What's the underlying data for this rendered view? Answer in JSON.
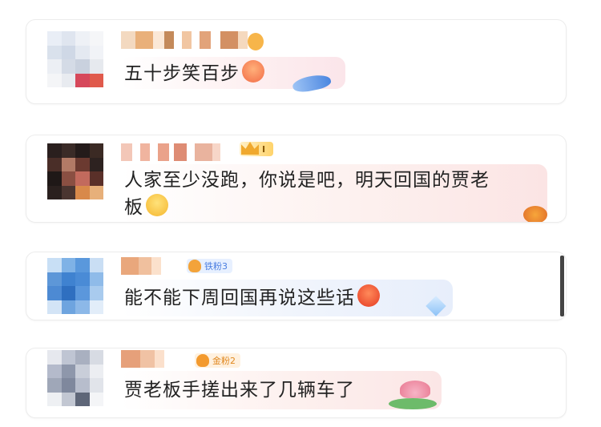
{
  "comments": [
    {
      "text": "五十步笑百步",
      "badge": ""
    },
    {
      "text_line1": "人家至少没跑，你说是吧，明天回国的贾老",
      "text_line2": "板",
      "badge": "I"
    },
    {
      "text": "能不能下周回国再说这些话",
      "badge": "铁粉3"
    },
    {
      "text": "贾老板手搓出来了几辆车了",
      "badge": "金粉2"
    }
  ],
  "icons": {
    "comment1_emoji": "laughing-face-icon",
    "comment1_decoration": "dolphin-icon",
    "comment2_emoji": "grinning-face-icon",
    "comment2_decoration": "gift-icon",
    "comment3_emoji": "angry-face-icon",
    "comment3_decoration": "diamond-icon",
    "comment4_decoration": "lotus-icon"
  },
  "colors": {
    "bubble_pink": "#fdeff0",
    "bubble_blue": "#eef3fb",
    "badge_blue": "#5a8ef0",
    "badge_gold": "#f3b13a",
    "badge_orange": "#ff9f43"
  }
}
